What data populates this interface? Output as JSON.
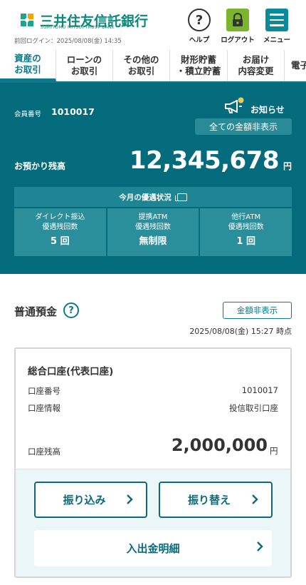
{
  "header": {
    "brand": "三井住友信託銀行",
    "brand_sub": "SUMITOMO MITSUI TRUST BANK",
    "last_login": "前回ログイン：2025/08/08(金) 14:35",
    "help_label": "ヘルプ",
    "logout_label": "ログアウト",
    "menu_label": "メニュー",
    "help_glyph": "?"
  },
  "tabs": [
    {
      "line1": "資産の",
      "line2": "お取引",
      "active": true
    },
    {
      "line1": "ローンの",
      "line2": "お取引",
      "active": false
    },
    {
      "line1": "その他の",
      "line2": "お取引",
      "active": false
    },
    {
      "line1": "財形貯蓄",
      "line2": "・積立貯蓄",
      "active": false
    },
    {
      "line1": "お届け",
      "line2": "内容変更",
      "active": false
    },
    {
      "line1": "電子",
      "line2": "",
      "active": false
    }
  ],
  "summary": {
    "member_label": "会員番号",
    "member_number": "1010017",
    "notice_label": "お知らせ",
    "hide_all_label": "全ての金額非表示",
    "balance_label": "お預かり残高",
    "balance_value": "12,345,678",
    "balance_unit": "円",
    "perk": {
      "title": "今月の優遇状況",
      "cells": [
        {
          "line1": "ダイレクト振込",
          "line2": "優遇残回数",
          "value": "5 回"
        },
        {
          "line1": "提携ATM",
          "line2": "優遇残回数",
          "value": "無制限"
        },
        {
          "line1": "他行ATM",
          "line2": "優遇残回数",
          "value": "1 回"
        }
      ]
    }
  },
  "deposit": {
    "title": "普通預金",
    "help_glyph": "?",
    "hide_label": "金額非表示",
    "timestamp": "2025/08/08(金) 15:27 時点",
    "account": {
      "name": "総合口座(代表口座)",
      "number_label": "口座番号",
      "number_value": "1010017",
      "info_label": "口座情報",
      "info_value": "投信取引口座",
      "balance_label": "口座残高",
      "balance_value": "2,000,000",
      "balance_unit": "円"
    },
    "transfer_label": "振り込み",
    "switch_label": "振り替え",
    "statement_label": "入出金明細"
  },
  "colors": {
    "brand": "#0b8a7c",
    "panel": "#036b7c",
    "accent": "#0b6b7c",
    "logout": "#7ab52b",
    "notice_dot": "#f2c94c"
  }
}
